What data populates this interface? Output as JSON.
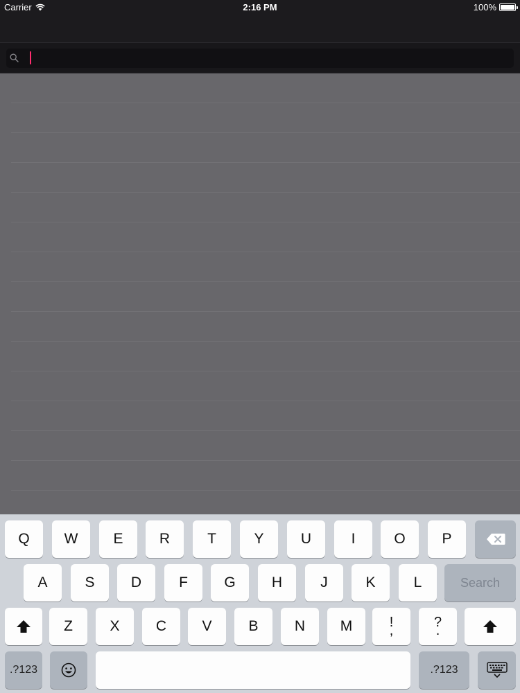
{
  "status_bar": {
    "carrier": "Carrier",
    "time": "2:16 PM",
    "battery": "100%",
    "battery_level": 1.0
  },
  "search": {
    "value": "",
    "placeholder": "",
    "icon": "search-icon"
  },
  "results": {
    "row_count": 14
  },
  "keyboard": {
    "row1": [
      "Q",
      "W",
      "E",
      "R",
      "T",
      "Y",
      "U",
      "I",
      "O",
      "P"
    ],
    "row2": [
      "A",
      "S",
      "D",
      "F",
      "G",
      "H",
      "J",
      "K",
      "L"
    ],
    "row3": [
      "Z",
      "X",
      "C",
      "V",
      "B",
      "N",
      "M"
    ],
    "exclam": {
      "top": "!",
      "bottom": ","
    },
    "question": {
      "top": "?",
      "bottom": "."
    },
    "search_label": "Search",
    "numbers_label": ".?123",
    "icons": {
      "backspace": "backspace-icon",
      "shift": "shift-icon",
      "emoji": "emoji-icon",
      "dismiss": "keyboard-dismiss-icon"
    },
    "colors": {
      "background": "#cfd3d9",
      "letter_key": "#fdfdfd",
      "function_key": "#adb4bd"
    }
  },
  "colors": {
    "chrome": "#1c1b1e",
    "results_background": "#68676b",
    "caret": "#ff2d6f"
  }
}
